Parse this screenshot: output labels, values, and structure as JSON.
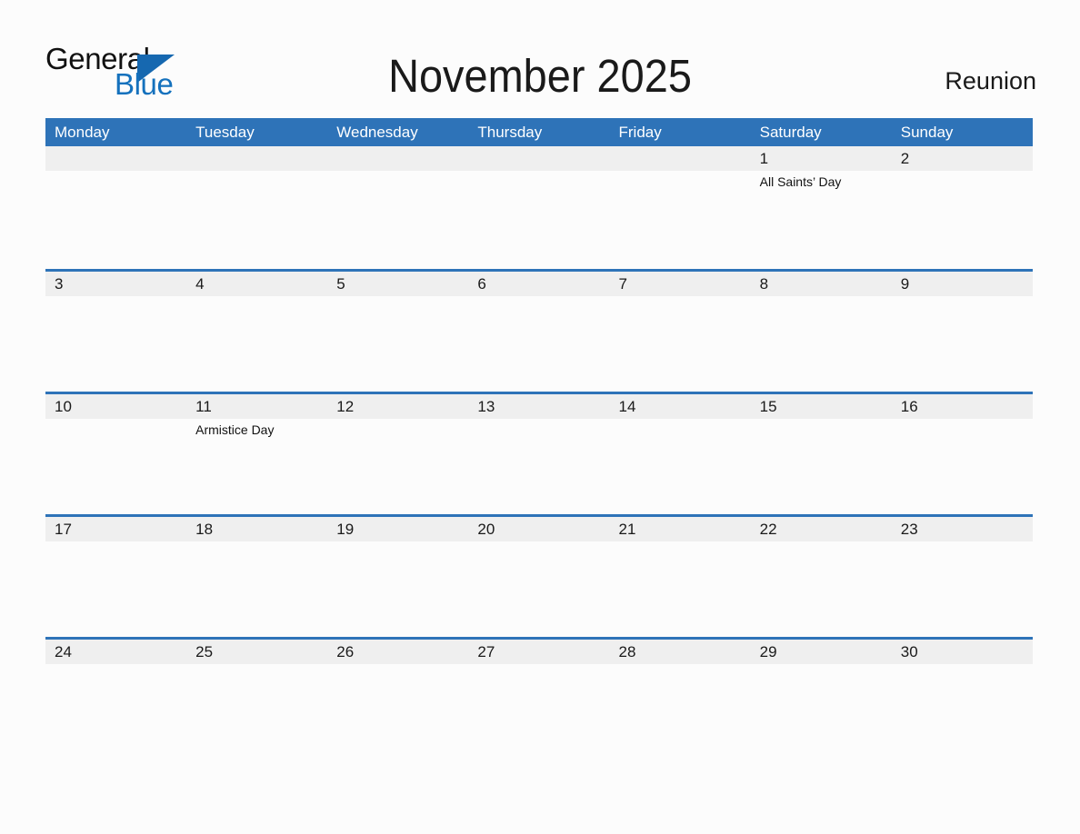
{
  "brand": {
    "name_top": "General",
    "name_bottom": "Blue",
    "triangle_color": "#1668b0",
    "blue_text_color": "#1471bd"
  },
  "header": {
    "title": "November 2025",
    "region": "Reunion"
  },
  "theme": {
    "header_blue": "#2e73b8",
    "date_strip_gray": "#efefef",
    "page_background": "#fcfcfc",
    "text_color": "#1a1a1a"
  },
  "calendar": {
    "month": "November",
    "year": "2025",
    "weekday_headers": [
      "Monday",
      "Tuesday",
      "Wednesday",
      "Thursday",
      "Friday",
      "Saturday",
      "Sunday"
    ],
    "weeks": [
      {
        "days": [
          {
            "num": "",
            "events": []
          },
          {
            "num": "",
            "events": []
          },
          {
            "num": "",
            "events": []
          },
          {
            "num": "",
            "events": []
          },
          {
            "num": "",
            "events": []
          },
          {
            "num": "1",
            "events": [
              "All Saints’ Day"
            ]
          },
          {
            "num": "2",
            "events": []
          }
        ]
      },
      {
        "days": [
          {
            "num": "3",
            "events": []
          },
          {
            "num": "4",
            "events": []
          },
          {
            "num": "5",
            "events": []
          },
          {
            "num": "6",
            "events": []
          },
          {
            "num": "7",
            "events": []
          },
          {
            "num": "8",
            "events": []
          },
          {
            "num": "9",
            "events": []
          }
        ]
      },
      {
        "days": [
          {
            "num": "10",
            "events": []
          },
          {
            "num": "11",
            "events": [
              "Armistice Day"
            ]
          },
          {
            "num": "12",
            "events": []
          },
          {
            "num": "13",
            "events": []
          },
          {
            "num": "14",
            "events": []
          },
          {
            "num": "15",
            "events": []
          },
          {
            "num": "16",
            "events": []
          }
        ]
      },
      {
        "days": [
          {
            "num": "17",
            "events": []
          },
          {
            "num": "18",
            "events": []
          },
          {
            "num": "19",
            "events": []
          },
          {
            "num": "20",
            "events": []
          },
          {
            "num": "21",
            "events": []
          },
          {
            "num": "22",
            "events": []
          },
          {
            "num": "23",
            "events": []
          }
        ]
      },
      {
        "days": [
          {
            "num": "24",
            "events": []
          },
          {
            "num": "25",
            "events": []
          },
          {
            "num": "26",
            "events": []
          },
          {
            "num": "27",
            "events": []
          },
          {
            "num": "28",
            "events": []
          },
          {
            "num": "29",
            "events": []
          },
          {
            "num": "30",
            "events": []
          }
        ]
      }
    ]
  }
}
